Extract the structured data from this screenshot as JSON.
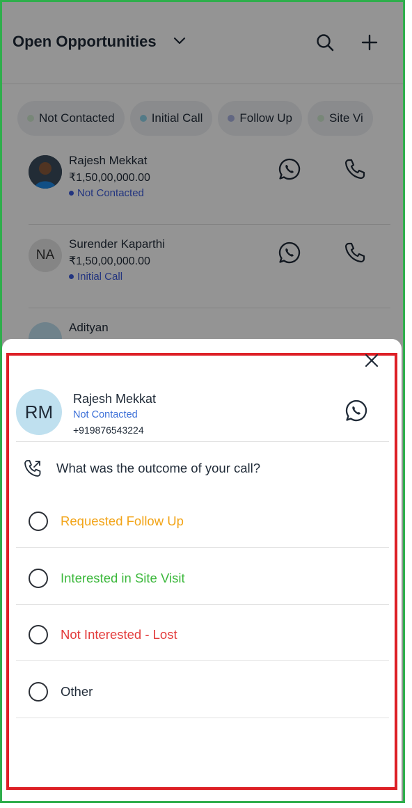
{
  "header": {
    "title": "Open Opportunities"
  },
  "filters": [
    {
      "label": "Not Contacted",
      "dot_color": "#cfe8cf"
    },
    {
      "label": "Initial Call",
      "dot_color": "#8fd3e8"
    },
    {
      "label": "Follow Up",
      "dot_color": "#aab2e0"
    },
    {
      "label": "Site Vi",
      "dot_color": "#cfe8cf"
    }
  ],
  "leads": [
    {
      "name": "Rajesh Mekkat",
      "amount": "₹1,50,00,000.00",
      "status": "Not Contacted",
      "avatar": "photo"
    },
    {
      "name": "Surender Kaparthi",
      "amount": "₹1,50,00,000.00",
      "status": "Initial Call",
      "avatar": "NA"
    },
    {
      "name": "Adityan",
      "amount": "",
      "status": "",
      "avatar": ""
    }
  ],
  "sheet": {
    "contact": {
      "initials": "RM",
      "name": "Rajesh Mekkat",
      "status": "Not Contacted",
      "phone": "+919876543224"
    },
    "question": "What was the outcome of your call?",
    "options": [
      {
        "label": "Requested Follow Up",
        "color": "#f2a417"
      },
      {
        "label": "Interested in Site Visit",
        "color": "#3cb83c"
      },
      {
        "label": "Not Interested - Lost",
        "color": "#e33b3b"
      },
      {
        "label": "Other",
        "color": "#1f2a37"
      }
    ]
  },
  "icons": {
    "close": "close-icon",
    "whatsapp": "whatsapp-icon",
    "phone": "phone-icon",
    "search": "search-icon",
    "add": "plus-icon",
    "dropdown": "chevron-down-icon",
    "outgoing_call": "phone-outgoing-icon"
  }
}
